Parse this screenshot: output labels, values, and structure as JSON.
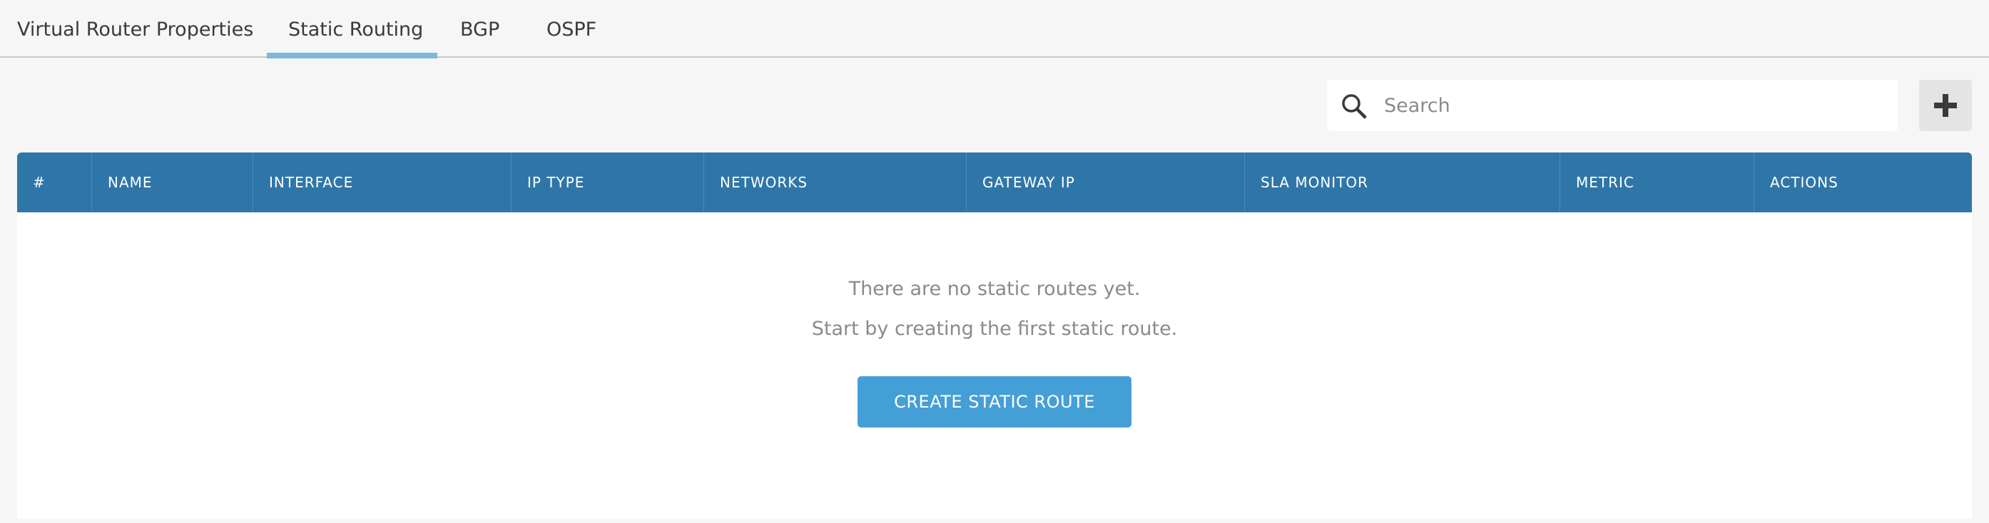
{
  "tabs": [
    {
      "label": "Virtual Router Properties"
    },
    {
      "label": "Static Routing"
    },
    {
      "label": "BGP"
    },
    {
      "label": "OSPF"
    }
  ],
  "active_tab": "Static Routing",
  "search": {
    "placeholder": "Search",
    "value": ""
  },
  "toolbar": {
    "add_icon": "plus-icon",
    "search_icon": "search-icon"
  },
  "table": {
    "columns": [
      "#",
      "NAME",
      "INTERFACE",
      "IP TYPE",
      "NETWORKS",
      "GATEWAY IP",
      "SLA MONITOR",
      "METRIC",
      "ACTIONS"
    ],
    "rows": []
  },
  "empty_state": {
    "line1": "There are no static routes yet.",
    "line2": "Start by creating the first static route.",
    "button_label": "CREATE STATIC ROUTE"
  },
  "colors": {
    "header_bg": "#2f76a8",
    "primary_button": "#459fd7",
    "active_tab_underline": "#7fb7da"
  }
}
